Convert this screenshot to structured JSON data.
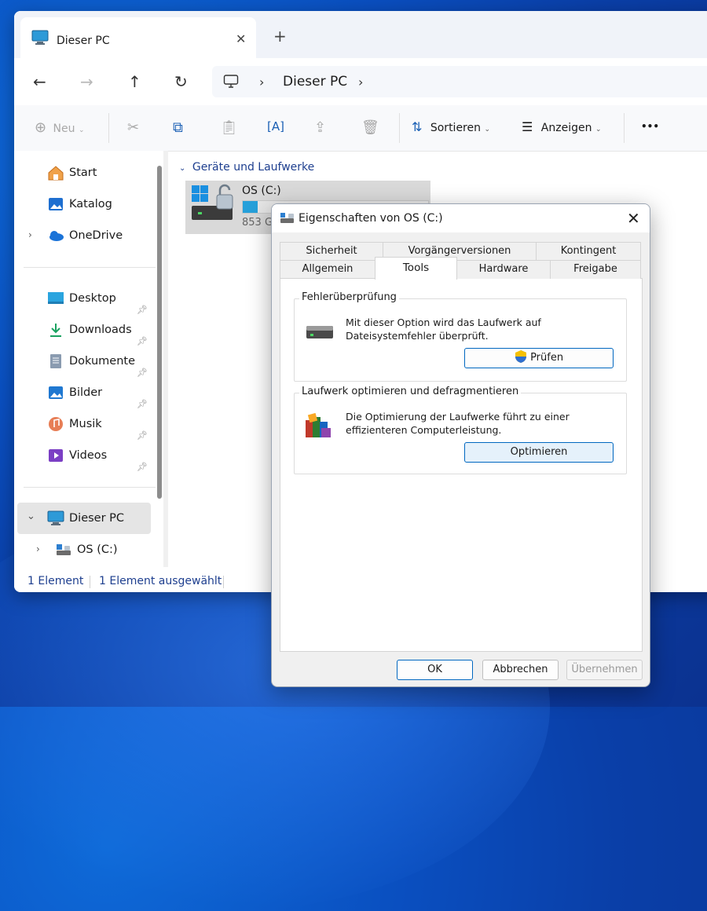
{
  "explorer": {
    "tab_title": "Dieser PC",
    "new_tab": "+",
    "address": {
      "crumb": "Dieser PC"
    },
    "toolbar": {
      "new_label": "Neu",
      "sort_label": "Sortieren",
      "view_label": "Anzeigen",
      "more_label": "•••"
    },
    "sidebar": {
      "items_top": [
        {
          "label": "Start",
          "icon": "home-icon"
        },
        {
          "label": "Katalog",
          "icon": "gallery-icon"
        },
        {
          "label": "OneDrive",
          "icon": "cloud-icon"
        }
      ],
      "items_pinned": [
        {
          "label": "Desktop",
          "icon": "desktop-icon"
        },
        {
          "label": "Downloads",
          "icon": "download-icon"
        },
        {
          "label": "Dokumente",
          "icon": "document-icon"
        },
        {
          "label": "Bilder",
          "icon": "pictures-icon"
        },
        {
          "label": "Musik",
          "icon": "music-icon"
        },
        {
          "label": "Videos",
          "icon": "videos-icon"
        }
      ],
      "this_pc": "Dieser PC",
      "drive": "OS (C:)"
    },
    "content": {
      "group_header": "Geräte und Laufwerke",
      "drive_name": "OS (C:)",
      "drive_size": "853 G",
      "drive_used_fraction": 0.08
    },
    "status": {
      "count": "1 Element",
      "selected": "1 Element ausgewählt"
    }
  },
  "dialog": {
    "title": "Eigenschaften von OS (C:)",
    "tabs_back": [
      "Sicherheit",
      "Vorgängerversionen",
      "Kontingent"
    ],
    "tabs_front": [
      "Allgemein",
      "Tools",
      "Hardware",
      "Freigabe"
    ],
    "active_tab": "Tools",
    "error_check": {
      "title": "Fehlerüberprüfung",
      "line1": "Mit dieser Option wird das Laufwerk auf",
      "line2": "Dateisystemfehler überprüft.",
      "button": "Prüfen"
    },
    "optimize": {
      "title": "Laufwerk optimieren und defragmentieren",
      "line1": "Die Optimierung der Laufwerke führt zu einer",
      "line2": "effizienteren Computerleistung.",
      "button": "Optimieren"
    },
    "buttons": {
      "ok": "OK",
      "cancel": "Abbrechen",
      "apply": "Übernehmen"
    }
  },
  "colors": {
    "accent": "#0067c0",
    "desktop": "#0a4fc0",
    "progress": "#26a0da"
  }
}
